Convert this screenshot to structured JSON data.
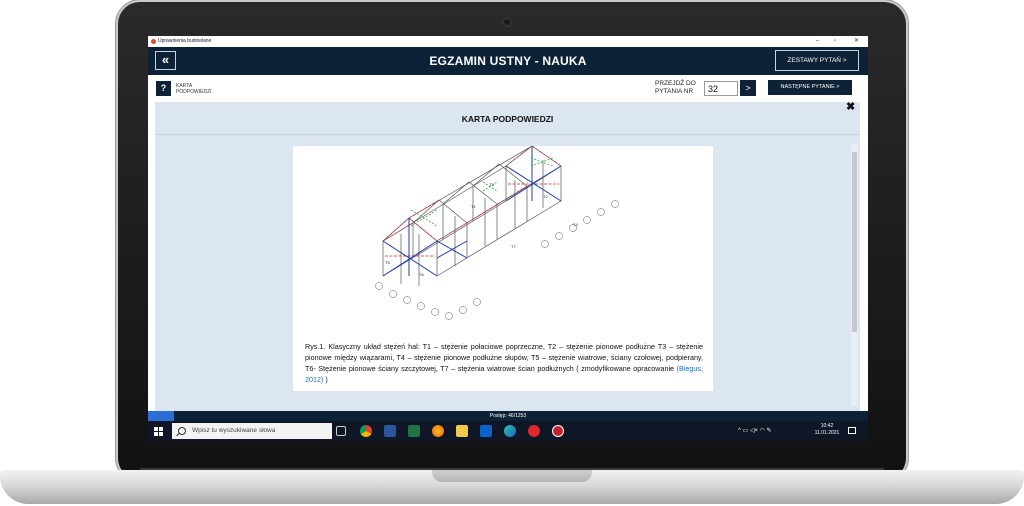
{
  "window": {
    "title": "Uprawnienia budowlane",
    "controls": [
      "–",
      "▫",
      "✕"
    ]
  },
  "header": {
    "back_glyph": "«",
    "title": "EGZAMIN USTNY - NAUKA",
    "sets_button": "ZESTAWY PYTAŃ  >"
  },
  "toolbar": {
    "help_glyph": "?",
    "help_label": "KARTA PODPOWIEDZI",
    "goto_label_line1": "PRZEJDŹ DO",
    "goto_label_line2": "PYTANIA NR",
    "goto_value": "32",
    "goto_button": ">",
    "next_button": "NASTĘPNE PYTANIE  >"
  },
  "panel": {
    "title": "KARTA PODPOWIEDZI",
    "close_glyph": "✖",
    "caption_text": "Rys.1. Klasyczny układ stężeń hal: T1 – stężenie połaciowe poprzeczne, T2 – stężenie pionowe podłużne T3 – stężenie pionowe między wiązarami, T4 – stężenie pionowe podłużne słupów, T5 – stężenie wiatrowe, ściany czołowej, podpierany, T6- Stężenie pionowe ściany szczytowej, T7 – stężenia wiatrowe ścian podłużnych ( zmodyfikowane opracowanie ",
    "caption_cite": "(Biegus, 2012)",
    "caption_end": " )",
    "figure_labels": [
      "T1",
      "T2",
      "T3",
      "T4",
      "T5",
      "T6",
      "T7"
    ]
  },
  "status": {
    "progress_text": "Postęp: 46/1253",
    "progress_value": 46,
    "progress_total": 1253
  },
  "taskbar": {
    "search_placeholder": "Wpisz tu wyszukiwane słowa",
    "apps": [
      "task-view-icon",
      "chrome-icon",
      "word-icon",
      "excel-icon",
      "firefox-icon",
      "file-explorer-icon",
      "outlook-icon",
      "edge-icon",
      "opera-icon",
      "app-icon"
    ],
    "tray_glyphs": "^  ▭  ◁×  ◠  ✎",
    "time": "10:42",
    "date": "11.01.2021"
  },
  "colors": {
    "navy": "#0d2236",
    "panel": "#dce6f1",
    "accent": "#2b6fd4",
    "link": "#1f6fb8"
  }
}
